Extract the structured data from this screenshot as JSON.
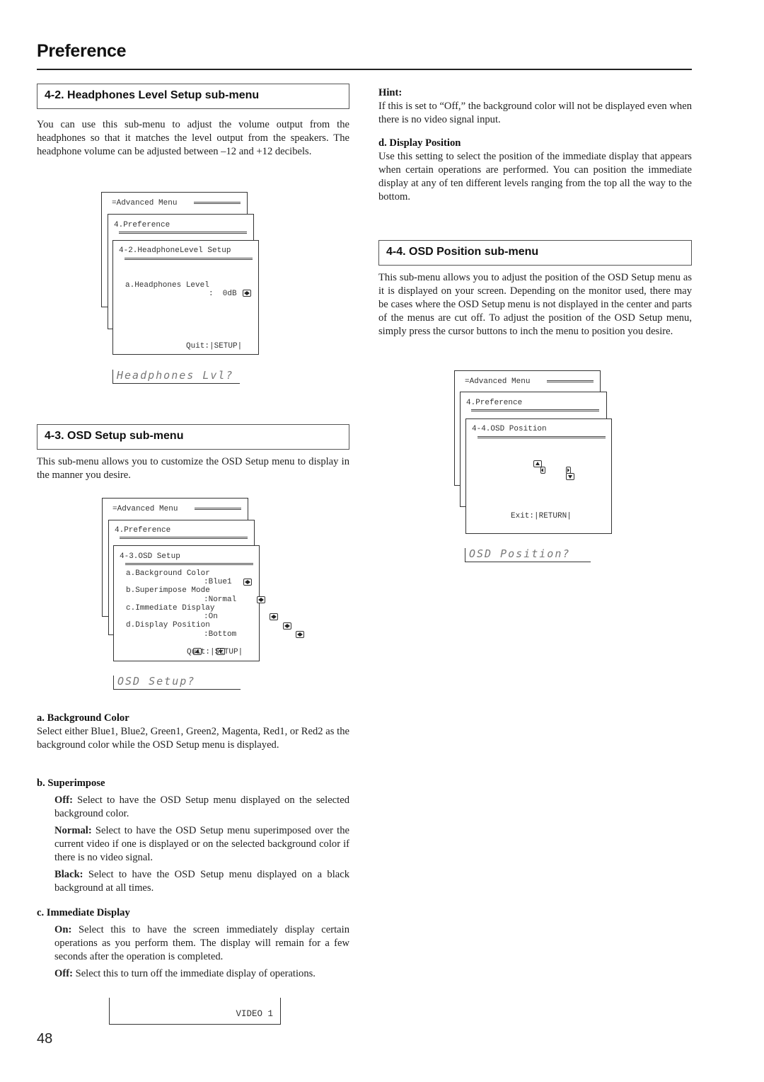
{
  "page": {
    "title": "Preference",
    "page_number": "48"
  },
  "left": {
    "sec42": {
      "heading": "4-2. Headphones Level Setup sub-menu",
      "body": "You can use this sub-menu to adjust the volume output from the headphones so that it matches the level output from the speakers. The headphone volume can be adjusted between –12 and +12 decibels.",
      "osd": {
        "advanced": "=Advanced Menu",
        "preference": "4.Preference",
        "title": "4-2.HeadphoneLevel Setup",
        "item_label": "a.Headphones Level",
        "item_value": ":  0dB",
        "quit": "Quit:|SETUP|",
        "lcd": "Headphones Lvl?"
      }
    },
    "sec43": {
      "heading": "4-3.  OSD Setup sub-menu",
      "body": "This sub-menu allows you to customize the OSD Setup menu to display in the manner you desire.",
      "osd": {
        "advanced": "=Advanced Menu",
        "preference": "4.Preference",
        "title": "4-3.OSD Setup",
        "items": [
          {
            "label": "a.Background Color",
            "value": ":Blue1"
          },
          {
            "label": "b.Superimpose Mode",
            "value": ":Normal"
          },
          {
            "label": "c.Immediate Display",
            "value": ":On"
          },
          {
            "label": "d.Display Position",
            "value": ":Bottom"
          }
        ],
        "quit": "Quit:|SETUP|",
        "lcd": "OSD Setup?"
      },
      "bg_color": {
        "heading": "a. Background Color",
        "body": "Select either Blue1, Blue2, Green1, Green2, Magenta, Red1, or Red2 as the background color while the OSD Setup menu is displayed."
      },
      "superimpose": {
        "heading": "b. Superimpose",
        "off_label": "Off:",
        "off_text": " Select to have the OSD Setup menu displayed on the selected background color.",
        "normal_label": "Normal:",
        "normal_text": " Select to have the OSD Setup menu superimposed over the current video if one is displayed or on the selected background color if there is no video signal.",
        "black_label": "Black:",
        "black_text": " Select to have the OSD Setup menu displayed on a black background at all times."
      },
      "immediate": {
        "heading": "c. Immediate Display",
        "on_label": "On:",
        "on_text": " Select this to have the screen immediately display certain operations as you perform them. The display will remain for a few seconds after the operation is completed.",
        "off_label": "Off:",
        "off_text": " Select this to turn off the immediate display of operations.",
        "display_text": "VIDEO 1"
      }
    }
  },
  "right": {
    "hint": {
      "heading": "Hint:",
      "body": "If this is set to “Off,” the background color will not be displayed even when there is no video signal input."
    },
    "display_position": {
      "heading": "d. Display Position",
      "body": "Use this setting to select the position of the immediate display that appears when certain operations are performed. You can position the immediate display at any of ten different levels ranging from the top all the way to the bottom."
    },
    "sec44": {
      "heading": "4-4.  OSD Position sub-menu",
      "body": "This sub-menu allows you to adjust the position of the OSD Setup menu as it is displayed on your screen. Depending on the monitor used, there may be cases where the OSD Setup menu is not displayed in the center and parts of the menus are cut off. To adjust the position of the OSD Setup menu, simply press the cursor buttons to inch the menu to position you desire.",
      "osd": {
        "advanced": "=Advanced Menu",
        "preference": "4.Preference",
        "title": "4-4.OSD Position",
        "exit": "Exit:|RETURN|",
        "lcd": "OSD Position?"
      }
    }
  }
}
